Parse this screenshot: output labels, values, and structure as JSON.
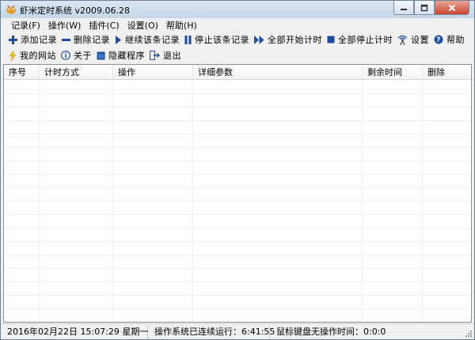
{
  "window": {
    "title": "虾米定时系统 v2009.06.28"
  },
  "menu": [
    {
      "label": "记录(F)"
    },
    {
      "label": "操作(W)"
    },
    {
      "label": "插件(C)"
    },
    {
      "label": "设置(O)"
    },
    {
      "label": "帮助(H)"
    }
  ],
  "toolbar": {
    "row1": [
      {
        "label": "添加记录",
        "icon": "plus-icon"
      },
      {
        "label": "删除记录",
        "icon": "minus-icon"
      },
      {
        "label": "继续该条记录",
        "icon": "play-icon"
      },
      {
        "label": "停止该条记录",
        "icon": "pause-icon"
      },
      {
        "label": "全部开始计时",
        "icon": "fast-forward-icon"
      },
      {
        "label": "全部停止计时",
        "icon": "stop-icon"
      },
      {
        "label": "设置",
        "icon": "antenna-icon"
      },
      {
        "label": "帮助",
        "icon": "help-icon"
      }
    ],
    "row2": [
      {
        "label": "我的网站",
        "icon": "lightning-icon"
      },
      {
        "label": "关于",
        "icon": "info-icon"
      },
      {
        "label": "隐藏程序",
        "icon": "window-icon"
      },
      {
        "label": "退出",
        "icon": "exit-icon"
      }
    ]
  },
  "list": {
    "columns": [
      "序号",
      "计时方式",
      "操作",
      "详细参数",
      "剩余时间",
      "删除"
    ]
  },
  "status": {
    "datetime": "2016年02月22日 15:07:29 星期一",
    "uptime": "操作系统已连续运行：6:41:55",
    "idle": "鼠标键盘无操作时间：0:0:0"
  },
  "colors": {
    "toolbar_icon_blue": "#1b4f9c",
    "close_button_red": "#c9452f"
  }
}
